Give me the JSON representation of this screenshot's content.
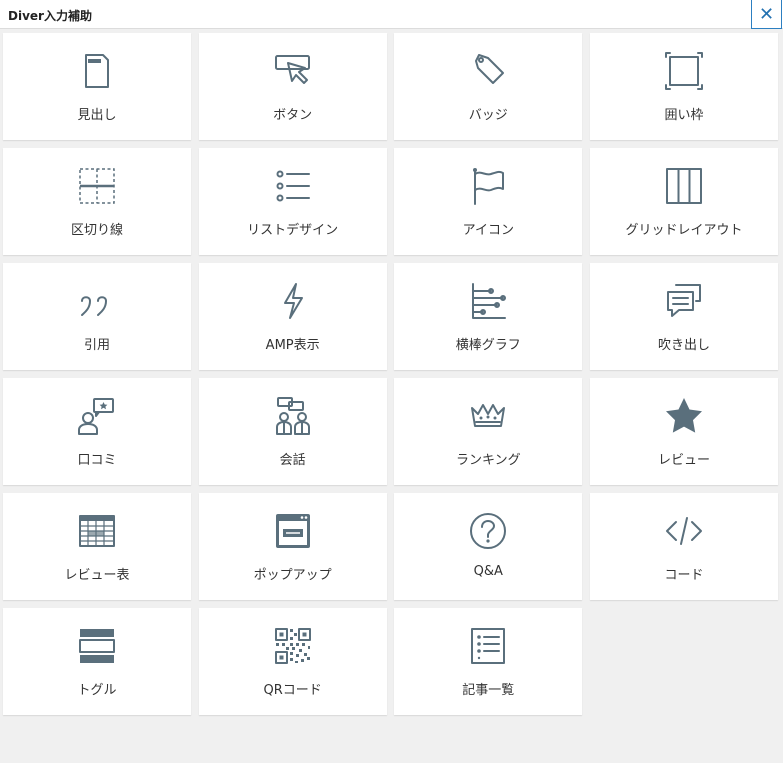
{
  "window": {
    "title": "Diver入力補助",
    "close_glyph": "✕"
  },
  "icon_color": "#5a6f7c",
  "tiles": [
    {
      "label": "見出し",
      "icon": "heading-icon"
    },
    {
      "label": "ボタン",
      "icon": "button-icon"
    },
    {
      "label": "バッジ",
      "icon": "tag-icon"
    },
    {
      "label": "囲い枠",
      "icon": "frame-icon"
    },
    {
      "label": "区切り線",
      "icon": "divider-icon"
    },
    {
      "label": "リストデザイン",
      "icon": "list-icon"
    },
    {
      "label": "アイコン",
      "icon": "flag-icon"
    },
    {
      "label": "グリッドレイアウト",
      "icon": "grid-layout-icon"
    },
    {
      "label": "引用",
      "icon": "quote-icon"
    },
    {
      "label": "AMP表示",
      "icon": "lightning-icon"
    },
    {
      "label": "横棒グラフ",
      "icon": "bar-graph-icon"
    },
    {
      "label": "吹き出し",
      "icon": "speech-bubble-icon"
    },
    {
      "label": "口コミ",
      "icon": "review-person-icon"
    },
    {
      "label": "会話",
      "icon": "conversation-icon"
    },
    {
      "label": "ランキング",
      "icon": "crown-icon"
    },
    {
      "label": "レビュー",
      "icon": "star-icon"
    },
    {
      "label": "レビュー表",
      "icon": "table-icon"
    },
    {
      "label": "ポップアップ",
      "icon": "popup-icon"
    },
    {
      "label": "Q&A",
      "icon": "question-icon"
    },
    {
      "label": "コード",
      "icon": "code-icon"
    },
    {
      "label": "トグル",
      "icon": "toggle-icon"
    },
    {
      "label": "QRコード",
      "icon": "qr-code-icon"
    },
    {
      "label": "記事一覧",
      "icon": "article-list-icon"
    }
  ]
}
